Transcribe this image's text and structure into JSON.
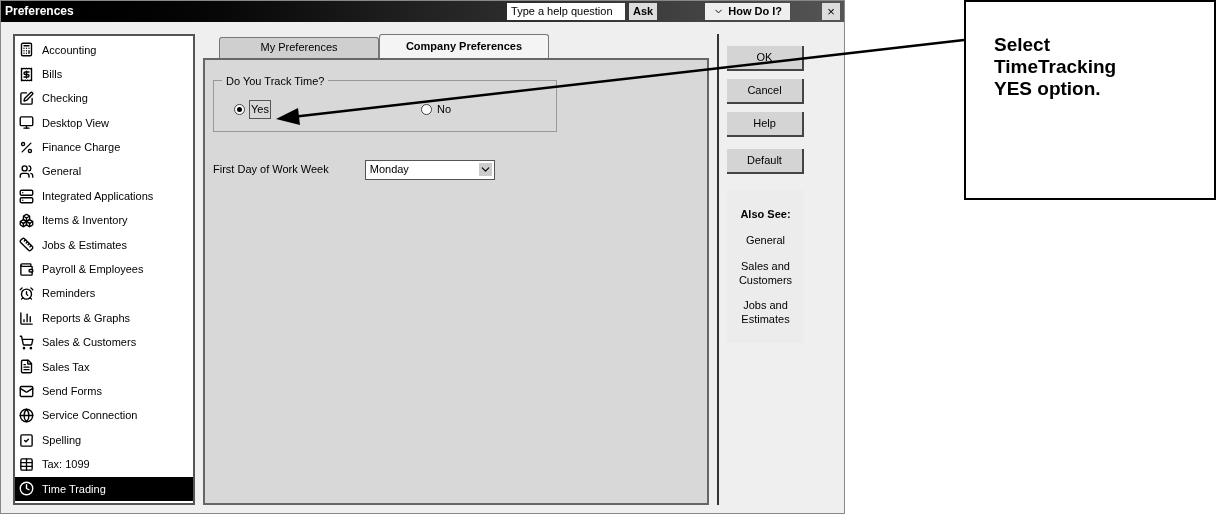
{
  "window": {
    "title": "Preferences"
  },
  "help_bar": {
    "placeholder": "Type a help question",
    "ask_button": "Ask",
    "how_do_i_button": "How Do I?",
    "close_button": "×"
  },
  "sidebar": {
    "items": [
      {
        "label": "Accounting",
        "selected": false
      },
      {
        "label": "Bills",
        "selected": false
      },
      {
        "label": "Checking",
        "selected": false
      },
      {
        "label": "Desktop View",
        "selected": false
      },
      {
        "label": "Finance Charge",
        "selected": false
      },
      {
        "label": "General",
        "selected": false
      },
      {
        "label": "Integrated Applications",
        "selected": false
      },
      {
        "label": "Items & Inventory",
        "selected": false
      },
      {
        "label": "Jobs & Estimates",
        "selected": false
      },
      {
        "label": "Payroll & Employees",
        "selected": false
      },
      {
        "label": "Reminders",
        "selected": false
      },
      {
        "label": "Reports & Graphs",
        "selected": false
      },
      {
        "label": "Sales & Customers",
        "selected": false
      },
      {
        "label": "Sales Tax",
        "selected": false
      },
      {
        "label": "Send Forms",
        "selected": false
      },
      {
        "label": "Service Connection",
        "selected": false
      },
      {
        "label": "Spelling",
        "selected": false
      },
      {
        "label": "Tax: 1099",
        "selected": false
      },
      {
        "label": "Time Trading",
        "selected": true
      }
    ]
  },
  "tabs": [
    {
      "label": "My Preferences",
      "selected": false
    },
    {
      "label": "Company Preferences",
      "selected": true
    }
  ],
  "time_tracking": {
    "group_label": "Do You Track Time?",
    "options": [
      {
        "label": "Yes",
        "selected": true
      },
      {
        "label": "No",
        "selected": false
      }
    ]
  },
  "work_week": {
    "label": "First Day of Work Week",
    "value": "Monday"
  },
  "buttons": [
    "OK",
    "Cancel",
    "Help",
    "Default"
  ],
  "also_see": {
    "title": "Also See:",
    "links": [
      "General",
      "Sales and Customers",
      "Jobs and Estimates"
    ]
  },
  "callout": {
    "text": "Select TimeTracking YES option."
  }
}
